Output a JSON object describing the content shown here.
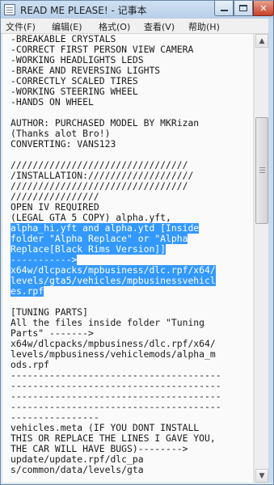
{
  "window": {
    "title": "READ ME PLEASE! - 记事本",
    "minimize_glyph": "",
    "close_glyph": "✕"
  },
  "menu": [
    {
      "label": "文件(F)"
    },
    {
      "label": "编辑(E)"
    },
    {
      "label": "格式(O)"
    },
    {
      "label": "查看(V)"
    },
    {
      "label": "帮助(H)"
    }
  ],
  "editor": {
    "lines": [
      {
        "text": "-BREAKABLE CRYSTALS",
        "sel": ""
      },
      {
        "text": "-CORRECT FIRST PERSON VIEW CAMERA",
        "sel": ""
      },
      {
        "text": "-WORKING HEADLIGHTS LEDS",
        "sel": ""
      },
      {
        "text": "-BRAKE AND REVERSING LIGHTS",
        "sel": ""
      },
      {
        "text": "-CORRECTLY SCALED TIRES",
        "sel": ""
      },
      {
        "text": "-WORKING STEERING WHEEL",
        "sel": ""
      },
      {
        "text": "-HANDS ON WHEEL",
        "sel": ""
      },
      {
        "text": "",
        "sel": ""
      },
      {
        "text": "AUTHOR: PURCHASED MODEL BY MKRizan",
        "sel": ""
      },
      {
        "text": "(Thanks alot Bro!)",
        "sel": ""
      },
      {
        "text": "CONVERTING: VANS123",
        "sel": ""
      },
      {
        "text": "",
        "sel": ""
      },
      {
        "text": "////////////////////////////////",
        "sel": ""
      },
      {
        "text": "/INSTALLATION:///////////////////",
        "sel": ""
      },
      {
        "text": "////////////////////////////////",
        "sel": ""
      },
      {
        "text": "////////////////",
        "sel": ""
      },
      {
        "text": "OPEN IV REQUIRED",
        "sel": ""
      },
      {
        "text": "(LEGAL GTA 5 COPY) alpha.yft,",
        "sel": ""
      },
      {
        "text": "",
        "sel": "alpha_hi.yft and alpha.ytd [Inside"
      },
      {
        "text": "",
        "sel": "folder \"Alpha Replace\" or \"Alpha"
      },
      {
        "text": "",
        "sel": "Replace[Black Rims Version]]"
      },
      {
        "text": "",
        "sel": "----------->"
      },
      {
        "text": "",
        "sel": "x64w/dlcpacks/mpbusiness/dlc.rpf/x64/"
      },
      {
        "text": "",
        "sel": "levels/gta5/vehicles/mpbusinessvehicl"
      },
      {
        "text": "",
        "sel": "es.rpf"
      },
      {
        "text": "",
        "sel": ""
      },
      {
        "text": "[TUNING PARTS]",
        "sel": ""
      },
      {
        "text": "All the files inside folder \"Tuning",
        "sel": ""
      },
      {
        "text": "Parts\" ------->",
        "sel": ""
      },
      {
        "text": "x64w/dlcpacks/mpbusiness/dlc.rpf/x64/",
        "sel": ""
      },
      {
        "text": "levels/mpbusiness/vehiclemods/alpha_m",
        "sel": ""
      },
      {
        "text": "ods.rpf",
        "sel": ""
      },
      {
        "text": "--------------------------------------",
        "sel": ""
      },
      {
        "text": "--------------------------------------",
        "sel": ""
      },
      {
        "text": "--------------------------------------",
        "sel": ""
      },
      {
        "text": "--------------------------------------",
        "sel": ""
      },
      {
        "text": "----------------",
        "sel": ""
      },
      {
        "text": "vehicles.meta (IF YOU DONT INSTALL",
        "sel": ""
      },
      {
        "text": "THIS OR REPLACE THE LINES I GAVE YOU,",
        "sel": ""
      },
      {
        "text": "THE CAR WILL HAVE BUGS)-------->",
        "sel": ""
      },
      {
        "text": "update/update.rpf/dlc_pa",
        "sel": ""
      },
      {
        "text": "s/common/data/levels/gta",
        "sel": ""
      }
    ]
  },
  "scrollbar": {
    "up_glyph": "▲",
    "down_glyph": "▼"
  }
}
